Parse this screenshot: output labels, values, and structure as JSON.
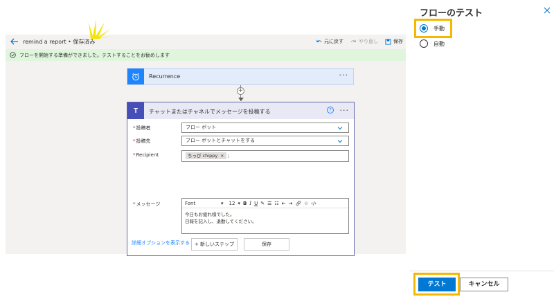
{
  "header": {
    "flow_name": "remind a report • 保存済み",
    "undo_label": "元に戻す",
    "redo_label": "やり直し",
    "save_label": "保存"
  },
  "infobar": {
    "message": "フローを開始する準備ができました。テストすることをお勧めします"
  },
  "trigger": {
    "label": "Recurrence",
    "icon": "alarm-clock-icon"
  },
  "action": {
    "icon": "teams-icon",
    "icon_letter": "T",
    "title": "チャットまたはチャネルでメッセージを投稿する",
    "fields": [
      {
        "label": "投稿者",
        "value": "フロー ボット"
      },
      {
        "label": "投稿先",
        "value": "フロー ボットとチャットをする"
      },
      {
        "label": "Recipient",
        "tag": "ちっぴ chippy",
        "tag_close": "×",
        "trailing": ";"
      },
      {
        "label": "メッセージ"
      }
    ],
    "editor": {
      "font": "Font",
      "size": "12",
      "body_line1": "今日もお疲れ様でした。",
      "body_line2": "日報を記入し、退勤してください。"
    },
    "advanced_label": "詳細オプションを表示する"
  },
  "footer": {
    "new_step_label": "+ 新しいステップ",
    "save_label": "保存"
  },
  "panel": {
    "title": "フローのテスト",
    "options": [
      {
        "label": "手動",
        "selected": true
      },
      {
        "label": "自動",
        "selected": false
      }
    ],
    "test_label": "テスト",
    "cancel_label": "キャンセル"
  },
  "colors": {
    "accent": "#0078d4",
    "highlight": "#f5b800",
    "teams": "#464eb8",
    "trigger": "#1f85ff",
    "success_bg": "#dff6dd"
  }
}
